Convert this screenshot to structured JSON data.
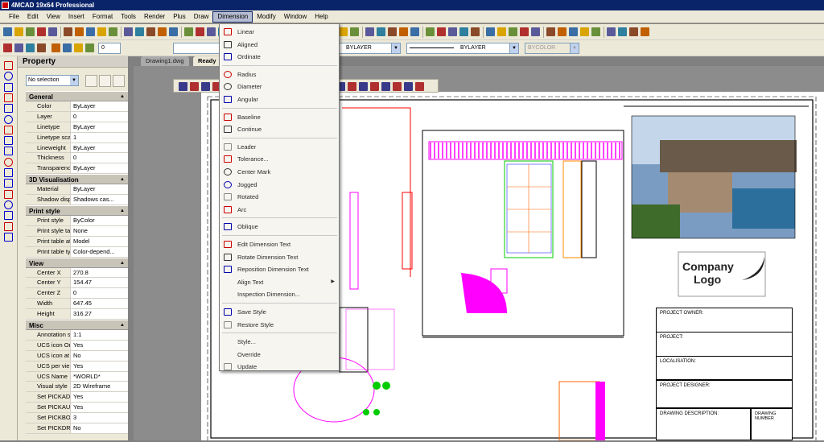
{
  "window": {
    "title": "4MCAD 19x64 Professional"
  },
  "menubar": [
    "File",
    "Edit",
    "View",
    "Insert",
    "Format",
    "Tools",
    "Render",
    "Plus",
    "Draw",
    "Dimension",
    "Modify",
    "Window",
    "Help"
  ],
  "toolbar": {
    "layer_combo": "BYLAYER",
    "linetype_combo": "BYLAYER",
    "color_combo": "BYCOLOR",
    "layer_value": "0"
  },
  "tabs": [
    "Drawing1.dwg",
    "Ready"
  ],
  "property_panel": {
    "title": "Property",
    "selection": "No selection",
    "sections": [
      {
        "name": "General",
        "rows": [
          [
            "Color",
            "ByLayer"
          ],
          [
            "Layer",
            "0"
          ],
          [
            "Linetype",
            "ByLayer"
          ],
          [
            "Linetype scale",
            "1"
          ],
          [
            "Lineweight",
            "ByLayer"
          ],
          [
            "Thickness",
            "0"
          ],
          [
            "Transparency",
            "ByLayer"
          ]
        ]
      },
      {
        "name": "3D Visualisation",
        "rows": [
          [
            "Material",
            "ByLayer"
          ],
          [
            "Shadow displ...",
            "Shadows cas..."
          ]
        ]
      },
      {
        "name": "Print style",
        "rows": [
          [
            "Print style",
            "ByColor"
          ],
          [
            "Print style table",
            "None"
          ],
          [
            "Print table att...",
            "Model"
          ],
          [
            "Print table type",
            "Color-depend..."
          ]
        ]
      },
      {
        "name": "View",
        "rows": [
          [
            "Center X",
            "270.8"
          ],
          [
            "Center Y",
            "154.47"
          ],
          [
            "Center Z",
            "0"
          ],
          [
            "Width",
            "647.45"
          ],
          [
            "Height",
            "316.27"
          ]
        ]
      },
      {
        "name": "Misc",
        "rows": [
          [
            "Annotation s...",
            "1:1"
          ],
          [
            "UCS icon On",
            "Yes"
          ],
          [
            "UCS icon at ...",
            "No"
          ],
          [
            "UCS per vie...",
            "Yes"
          ],
          [
            "UCS Name",
            "*WORLD*"
          ],
          [
            "Visual style",
            "2D Wireframe"
          ],
          [
            "Set PICKADD",
            "Yes"
          ],
          [
            "Set PICKAUTO",
            "Yes"
          ],
          [
            "Set PICKBOX",
            "3"
          ],
          [
            "Set PICKDR...",
            "No"
          ]
        ]
      }
    ]
  },
  "dimension_menu": [
    {
      "label": "Linear",
      "icon": "linear-icon"
    },
    {
      "label": "Aligned",
      "icon": "aligned-icon"
    },
    {
      "label": "Ordinate",
      "icon": "ordinate-icon"
    },
    {
      "sep": true
    },
    {
      "label": "Radius",
      "icon": "radius-icon"
    },
    {
      "label": "Diameter",
      "icon": "diameter-icon"
    },
    {
      "label": "Angular",
      "icon": "angular-icon"
    },
    {
      "sep": true
    },
    {
      "label": "Baseline",
      "icon": "baseline-icon"
    },
    {
      "label": "Continue",
      "icon": "continue-icon"
    },
    {
      "sep": true
    },
    {
      "label": "Leader",
      "icon": "leader-icon"
    },
    {
      "label": "Tolerance...",
      "icon": "tolerance-icon"
    },
    {
      "label": "Center Mark",
      "icon": "center-mark-icon"
    },
    {
      "label": "Jogged",
      "icon": "jogged-icon"
    },
    {
      "label": "Rotated",
      "icon": "rotated-icon"
    },
    {
      "label": "Arc",
      "icon": "arc-icon"
    },
    {
      "sep": true
    },
    {
      "label": "Oblique",
      "icon": "oblique-icon"
    },
    {
      "sep": true
    },
    {
      "label": "Edit Dimension Text",
      "icon": "edit-dim-text-icon"
    },
    {
      "label": "Rotate Dimension Text",
      "icon": "rotate-dim-text-icon"
    },
    {
      "label": "Reposition Dimension Text",
      "icon": "reposition-dim-text-icon"
    },
    {
      "label": "Align Text",
      "icon": "",
      "submenu": true
    },
    {
      "label": "Inspection Dimension...",
      "icon": ""
    },
    {
      "sep": true
    },
    {
      "label": "Save Style",
      "icon": "save-style-icon"
    },
    {
      "label": "Restore Style",
      "icon": "restore-style-icon"
    },
    {
      "sep": true
    },
    {
      "label": "Style...",
      "icon": ""
    },
    {
      "label": "Override",
      "icon": ""
    },
    {
      "label": "Update",
      "icon": "update-icon"
    }
  ],
  "drawing": {
    "logo_line1": "Company",
    "logo_line2": "Logo",
    "title_block": [
      "PROJECT OWNER:",
      "PROJECT:",
      "LOCALISATION:",
      "PROJECT DESIGNER:",
      "DRAWING DESCRIPTION:"
    ],
    "drawing_number": "DRAWING NUMBER"
  },
  "colors": {
    "accent": "#0a246a",
    "magenta": "#ff00ff",
    "menu_bg": "#ece9d8"
  }
}
